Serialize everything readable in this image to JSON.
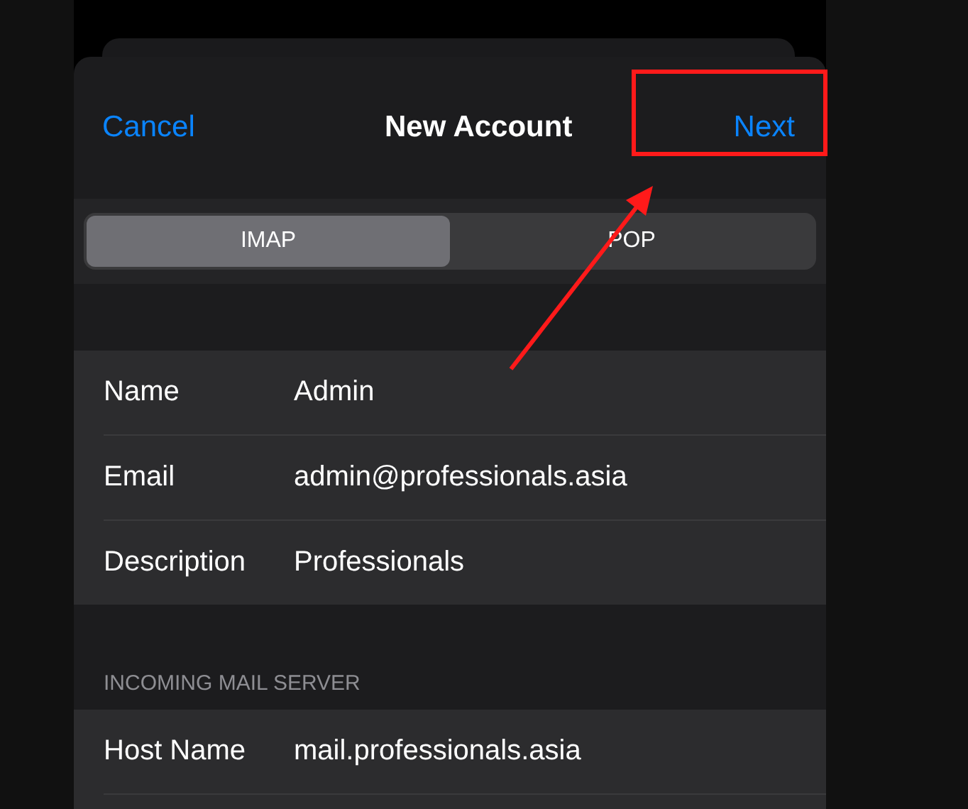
{
  "nav": {
    "cancel": "Cancel",
    "title": "New Account",
    "next": "Next"
  },
  "segments": [
    {
      "label": "IMAP",
      "selected": true
    },
    {
      "label": "POP",
      "selected": false
    }
  ],
  "account_fields": [
    {
      "label": "Name",
      "value": "Admin"
    },
    {
      "label": "Email",
      "value": "admin@professionals.asia"
    },
    {
      "label": "Description",
      "value": "Professionals"
    }
  ],
  "incoming_mail_server": {
    "header": "INCOMING MAIL SERVER",
    "fields": [
      {
        "label": "Host Name",
        "value": "mail.professionals.asia"
      }
    ]
  }
}
